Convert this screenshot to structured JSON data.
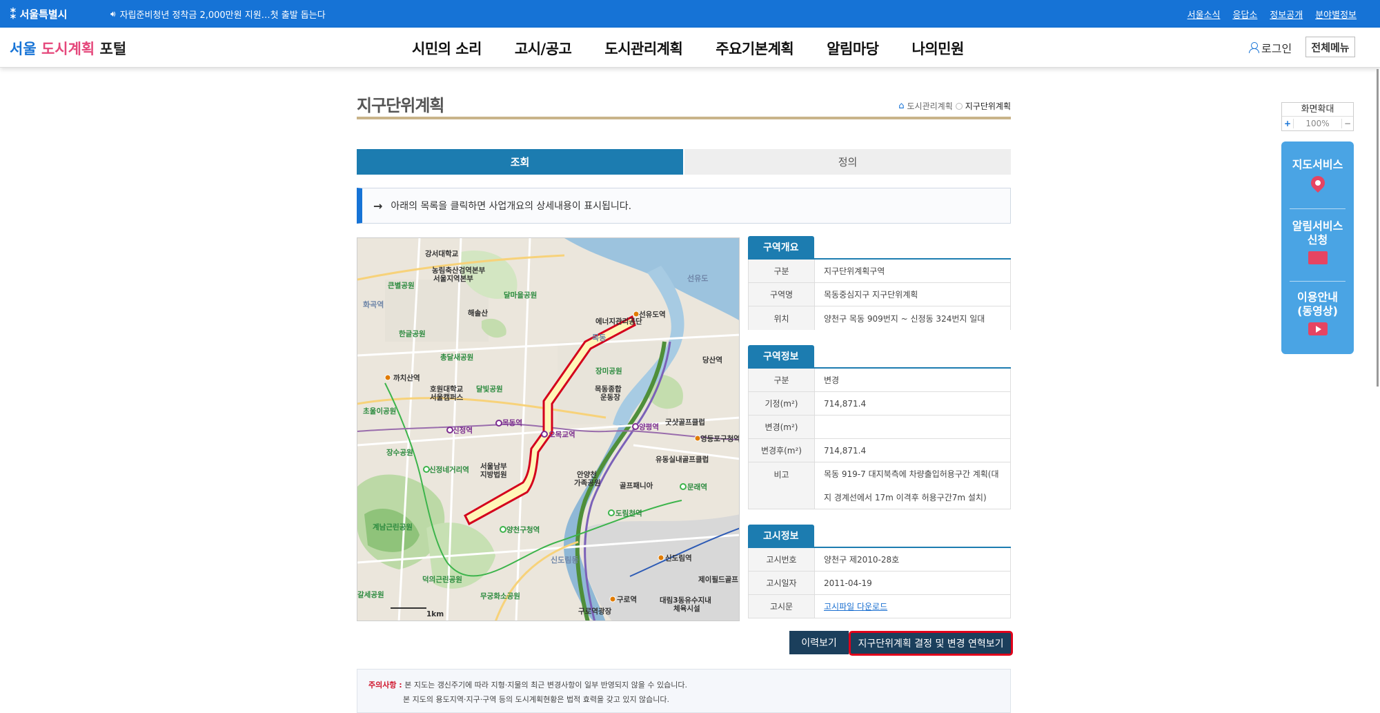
{
  "topbar": {
    "logo": "서울특별시",
    "notice": "자립준비청년 정착금 2,000만원 지원…첫 출발 돕는다",
    "links": [
      "서울소식",
      "응답소",
      "정보공개",
      "분야별정보"
    ]
  },
  "header": {
    "portal": {
      "part1": "서울 ",
      "part2": "도시계획",
      "part3": " 포털"
    },
    "nav": [
      "시민의 소리",
      "고시/공고",
      "도시관리계획",
      "주요기본계획",
      "알림마당",
      "나의민원"
    ],
    "login": "로그인",
    "all_menu": "전체메뉴"
  },
  "page": {
    "title": "지구단위계획",
    "breadcrumb": [
      "도시관리계획",
      "지구단위계획"
    ]
  },
  "tabs": [
    {
      "label": "조회",
      "active": true
    },
    {
      "label": "정의",
      "active": false
    }
  ],
  "info_message": "아래의 목록을 클릭하면 사업개요의 상세내용이 표시됩니다.",
  "map": {
    "labels": {
      "l1": "강서대학교",
      "l2": "농림축산검역본부",
      "l3": "서울지역본부",
      "l4": "큰별공원",
      "l5": "달마을공원",
      "l6": "해솔산",
      "l7": "에너지관리공단",
      "l8": "한글공원",
      "l9": "총달새공원",
      "l10": "까치산역",
      "l11": "호원대학교",
      "l12": "서울캠퍼스",
      "l13": "달빛공원",
      "l14": "장미공원",
      "l15": "목동종합",
      "l16": "운동장",
      "l17": "초울이공원",
      "l18": "목동역",
      "l19": "오목교역",
      "l20": "신정역",
      "l21": "양평역",
      "l22": "굿샷골프클럽",
      "l23": "영등포구청역",
      "l24": "장수공원",
      "l25": "신정네거리역",
      "l26": "서울남부",
      "l27": "지방법원",
      "l28": "안양천",
      "l29": "가족공원",
      "l30": "유동실내골프클럽",
      "l31": "문래역",
      "l32": "골프패니아",
      "l33": "도림천역",
      "l34": "양천구청역",
      "l35": "계남근린공원",
      "l36": "신도림역",
      "l37": "덕의근린공원",
      "l38": "무궁화소공원",
      "l39": "구로역",
      "l40": "갈세공원",
      "l41": "구로역광장",
      "l42": "대림3동유수지내",
      "l43": "체육시설",
      "l44": "제이필드골프",
      "l45": "선유도",
      "l46": "선유도역",
      "l47": "당산역",
      "l48": "신도림동",
      "l49": "화곡역",
      "l50": "목동"
    },
    "scale": "1km"
  },
  "sections": {
    "overview": {
      "title": "구역개요",
      "rows": [
        {
          "k": "구분",
          "v": "지구단위계획구역"
        },
        {
          "k": "구역명",
          "v": "목동중심지구 지구단위계획"
        },
        {
          "k": "위치",
          "v": "양천구 목동 909번지 ~ 신정동 324번지 일대"
        }
      ]
    },
    "info": {
      "title": "구역정보",
      "rows": [
        {
          "k": "구분",
          "v": "변경"
        },
        {
          "k": "기정(m²)",
          "v": "714,871.4"
        },
        {
          "k": "변경(m²)",
          "v": ""
        },
        {
          "k": "변경후(m²)",
          "v": "714,871.4"
        },
        {
          "k": "비고",
          "v": "목동 919-7 대지북측에 차량출입허용구간 계획(대지 경계선에서 17m 이격후 허용구간7m 설치)"
        }
      ]
    },
    "notice": {
      "title": "고시정보",
      "rows": [
        {
          "k": "고시번호",
          "v": "양천구 제2010-28호"
        },
        {
          "k": "고시일자",
          "v": "2011-04-19"
        },
        {
          "k": "고시문",
          "v": "고시파일 다운로드"
        }
      ]
    }
  },
  "buttons": {
    "history": "이력보기",
    "change": "지구단위계획 결정 및 변경 연혁보기"
  },
  "caution": {
    "title": "주의사항 :",
    "line1": "본 지도는 갱신주기에 따라 지형·지물의 최근 변경사항이 일부 반영되지 않을 수 있습니다.",
    "line2": "본 지도의 용도지역·지구·구역 등의 도시계획현황은 법적 효력을 갖고 있지 않습니다."
  },
  "side": {
    "zoom_title": "화면확대",
    "zoom_plus": "+",
    "zoom_minus": "−",
    "zoom_level": "100%",
    "items": [
      "지도서비스",
      "알림서비스",
      "신청",
      "이용안내",
      "(동영상)"
    ]
  },
  "colors": {
    "topbar": "#1673d6",
    "tab_active": "#1c7cb0",
    "button": "#1b3f5c",
    "highlight": "#e0001a",
    "quick": "#4aa4e4"
  }
}
